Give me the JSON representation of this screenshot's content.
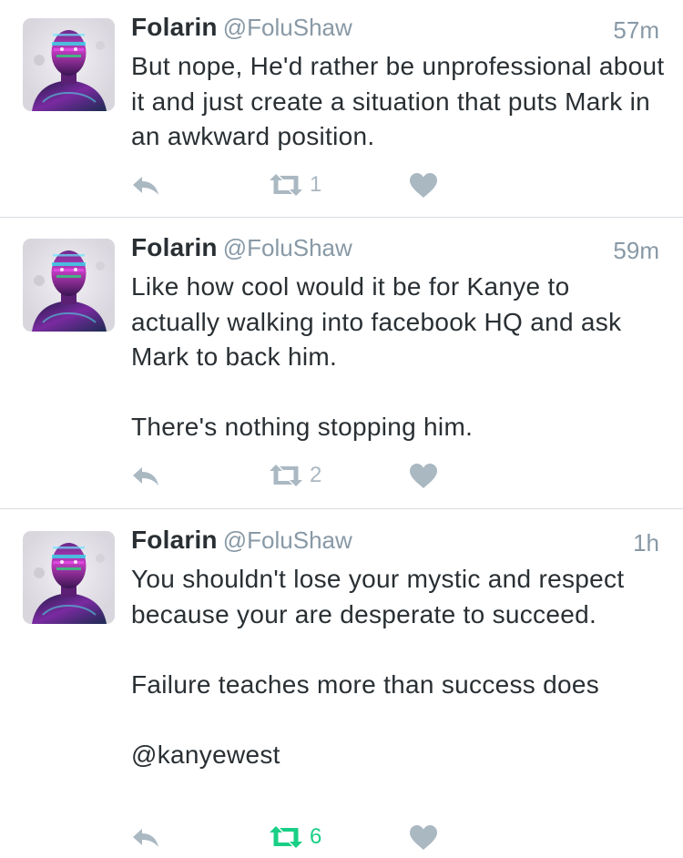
{
  "tweets": [
    {
      "name": "Folarin",
      "handle": "@FoluShaw",
      "time": "57m",
      "text": "But nope, He'd rather be unprofessional about it and just create a situation that puts Mark in an awkward position.",
      "retweets": "1",
      "retweet_active": false
    },
    {
      "name": "Folarin",
      "handle": "@FoluShaw",
      "time": "59m",
      "text": "Like how cool would it be for Kanye to actually walking into facebook HQ and ask Mark to back him.\n\nThere's nothing stopping him.",
      "retweets": "2",
      "retweet_active": false
    },
    {
      "name": "Folarin",
      "handle": "@FoluShaw",
      "time": "1h",
      "text": "You shouldn't lose your mystic and respect because your are desperate to succeed.\n\nFailure teaches more than success does\n\n@kanyewest",
      "retweets": "6",
      "retweet_active": true
    }
  ],
  "icons": {
    "reply": "reply-icon",
    "retweet": "retweet-icon",
    "like": "heart-icon"
  },
  "colors": {
    "text": "#292f33",
    "muted": "#8899a6",
    "icon": "#aab8c2",
    "retweet_active": "#19cf86",
    "divider": "#d9dde0"
  }
}
